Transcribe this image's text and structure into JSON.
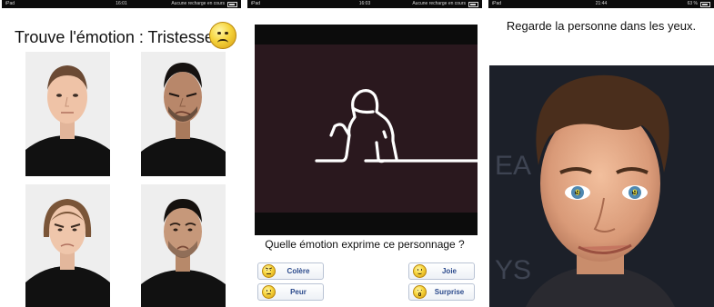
{
  "screen1": {
    "statusbar": {
      "device": "iPad",
      "time": "16:01",
      "battery_status": "Aucune recharge en cours"
    },
    "title": "Trouve l'émotion : Tristesse",
    "title_icon": "sad-face-emoji-icon",
    "photos": [
      "neutral-face-photo",
      "disgust-face-photo",
      "angry-face-photo",
      "sad-face-photo"
    ]
  },
  "screen2": {
    "statusbar": {
      "device": "iPad",
      "time": "16:03",
      "battery_status": "Aucune recharge en cours"
    },
    "video": "cartoon-character-video",
    "question": "Quelle émotion exprime ce personnage ?",
    "buttons": [
      {
        "label": "Colère",
        "icon": "angry-face-icon"
      },
      {
        "label": "Joie",
        "icon": "happy-face-icon"
      },
      {
        "label": "Peur",
        "icon": "fear-face-icon"
      },
      {
        "label": "Surprise",
        "icon": "surprise-face-icon"
      }
    ]
  },
  "screen3": {
    "statusbar": {
      "device": "iPad",
      "time": "21:44",
      "battery": "63 %"
    },
    "instruction": "Regarde la personne dans les yeux.",
    "photo": "portrait-photo"
  },
  "colors": {
    "button_text": "#2b4a8c",
    "button_border": "#b9c3d4",
    "emoji_yellow": "#f6d43c"
  }
}
